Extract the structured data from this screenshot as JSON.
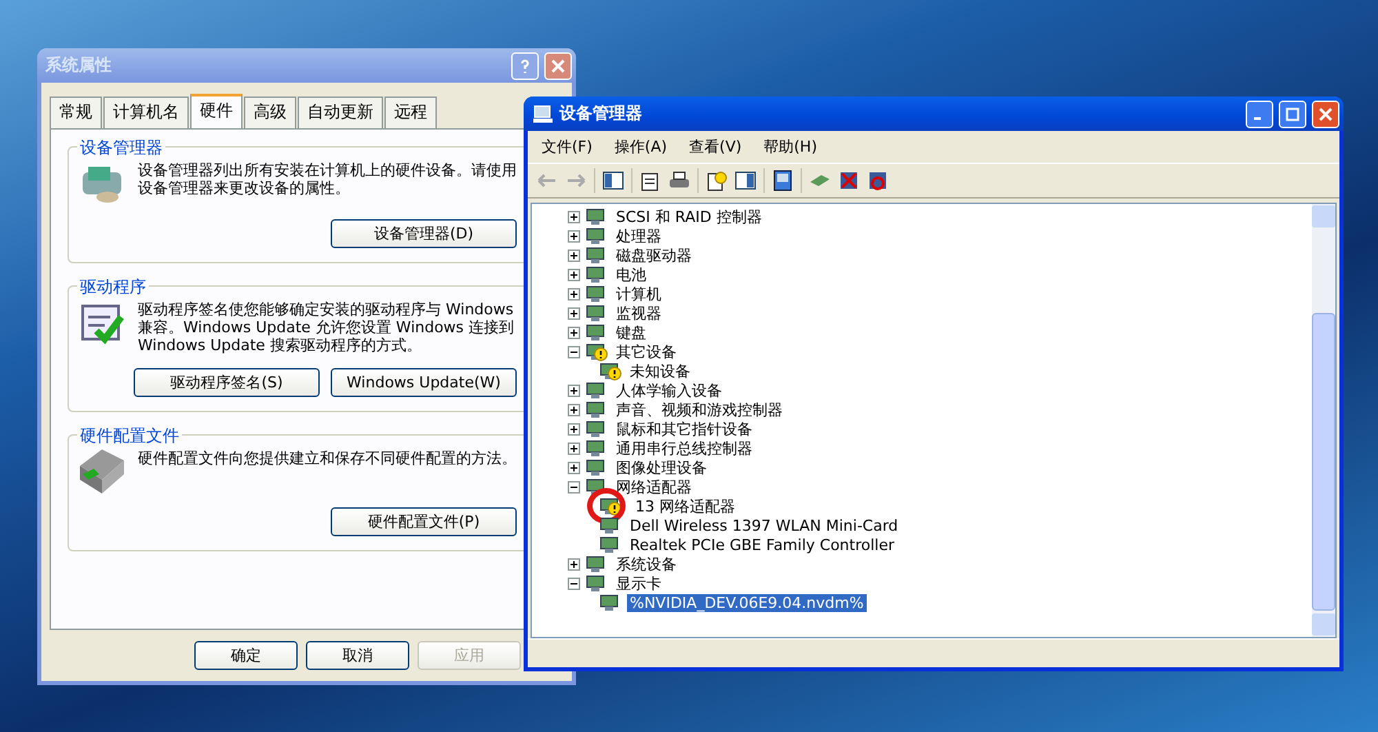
{
  "dialog": {
    "title": "系统属性",
    "tabs": [
      {
        "label": "常规",
        "selected": false
      },
      {
        "label": "计算机名",
        "selected": false
      },
      {
        "label": "硬件",
        "selected": true
      },
      {
        "label": "高级",
        "selected": false
      },
      {
        "label": "自动更新",
        "selected": false
      },
      {
        "label": "远程",
        "selected": false
      }
    ],
    "groups": [
      {
        "title": "设备管理器",
        "description": "设备管理器列出所有安装在计算机上的硬件设备。请使用设备管理器来更改设备的属性。",
        "buttons": [
          "设备管理器(D)"
        ]
      },
      {
        "title": "驱动程序",
        "description": "驱动程序签名使您能够确定安装的驱动程序与 Windows 兼容。Windows Update 允许您设置 Windows 连接到 Windows Update 搜索驱动程序的方式。",
        "buttons": [
          "驱动程序签名(S)",
          "Windows Update(W)"
        ]
      },
      {
        "title": "硬件配置文件",
        "description": "硬件配置文件向您提供建立和保存不同硬件配置的方法。",
        "buttons": [
          "硬件配置文件(P)"
        ]
      }
    ],
    "buttons": [
      {
        "label": "确定",
        "disabled": false
      },
      {
        "label": "取消",
        "disabled": false
      },
      {
        "label": "应用",
        "disabled": true
      }
    ]
  },
  "device_manager": {
    "title": "设备管理器",
    "menu": [
      "文件(F)",
      "操作(A)",
      "查看(V)",
      "帮助(H)"
    ],
    "tree": [
      {
        "label": "SCSI 和 RAID 控制器",
        "expanded": false,
        "selected": false,
        "problem": false,
        "circled": false
      },
      {
        "label": "处理器",
        "expanded": false,
        "selected": false,
        "problem": false,
        "circled": false
      },
      {
        "label": "磁盘驱动器",
        "expanded": false,
        "selected": false,
        "problem": false,
        "circled": false
      },
      {
        "label": "电池",
        "expanded": false,
        "selected": false,
        "problem": false,
        "circled": false
      },
      {
        "label": "计算机",
        "expanded": false,
        "selected": false,
        "problem": false,
        "circled": false
      },
      {
        "label": "监视器",
        "expanded": false,
        "selected": false,
        "problem": false,
        "circled": false
      },
      {
        "label": "键盘",
        "expanded": false,
        "selected": false,
        "problem": false,
        "circled": false
      },
      {
        "label": "其它设备",
        "expanded": true,
        "selected": false,
        "problem": true,
        "circled": false,
        "children": [
          {
            "label": "未知设备",
            "selected": false,
            "problem": true,
            "circled": false
          }
        ]
      },
      {
        "label": "人体学输入设备",
        "expanded": false,
        "selected": false,
        "problem": false,
        "circled": false
      },
      {
        "label": "声音、视频和游戏控制器",
        "expanded": false,
        "selected": false,
        "problem": false,
        "circled": false
      },
      {
        "label": "鼠标和其它指针设备",
        "expanded": false,
        "selected": false,
        "problem": false,
        "circled": false
      },
      {
        "label": "通用串行总线控制器",
        "expanded": false,
        "selected": false,
        "problem": false,
        "circled": false
      },
      {
        "label": "图像处理设备",
        "expanded": false,
        "selected": false,
        "problem": false,
        "circled": false
      },
      {
        "label": "网络适配器",
        "expanded": true,
        "selected": false,
        "problem": false,
        "circled": false,
        "children": [
          {
            "label": "13 网络适配器",
            "selected": false,
            "problem": true,
            "circled": true
          },
          {
            "label": "Dell Wireless 1397 WLAN Mini-Card",
            "selected": false,
            "problem": false,
            "circled": false
          },
          {
            "label": "Realtek PCIe GBE Family Controller",
            "selected": false,
            "problem": false,
            "circled": false
          }
        ]
      },
      {
        "label": "系统设备",
        "expanded": false,
        "selected": false,
        "problem": false,
        "circled": false
      },
      {
        "label": "显示卡",
        "expanded": true,
        "selected": false,
        "problem": false,
        "circled": false,
        "children": [
          {
            "label": "%NVIDIA_DEV.06E9.04.nvdm%",
            "selected": true,
            "problem": false,
            "circled": false
          }
        ]
      }
    ]
  }
}
